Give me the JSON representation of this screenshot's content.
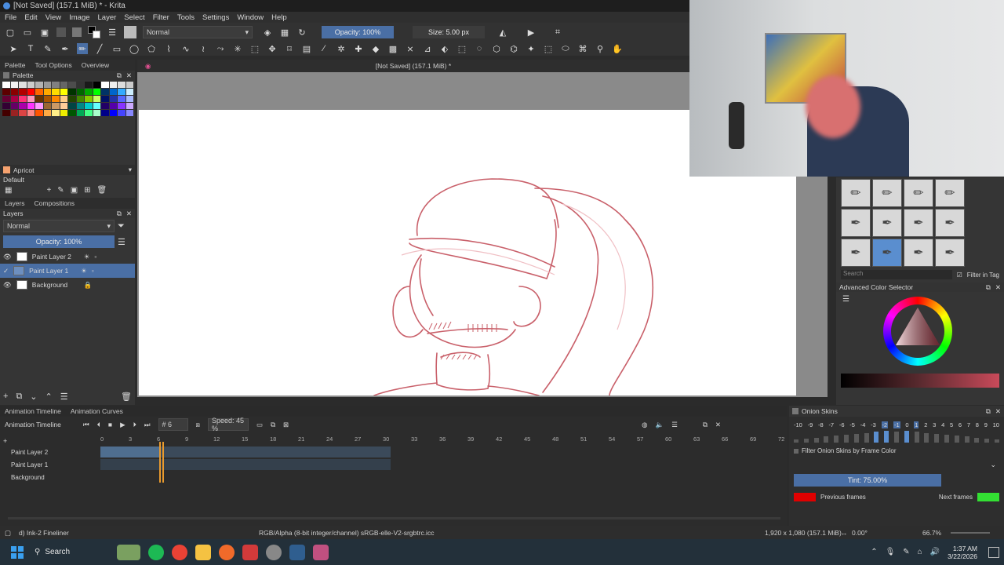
{
  "window": {
    "title": "[Not Saved]  (157.1 MiB) * - Krita"
  },
  "menu": [
    "File",
    "Edit",
    "View",
    "Image",
    "Layer",
    "Select",
    "Filter",
    "Tools",
    "Settings",
    "Window",
    "Help"
  ],
  "toolbar": {
    "blend_mode": "Normal",
    "opacity": "Opacity: 100%",
    "size": "Size: 5.00 px"
  },
  "left_tabs": [
    "Palette",
    "Tool Options",
    "Overview"
  ],
  "palette": {
    "title": "Palette",
    "current_color": "Apricot",
    "palette_name": "Default"
  },
  "layers": {
    "tabs": [
      "Layers",
      "Compositions"
    ],
    "title": "Layers",
    "blend_mode": "Normal",
    "opacity": "Opacity:  100%",
    "items": [
      {
        "name": "Paint Layer 2"
      },
      {
        "name": "Paint Layer 1"
      },
      {
        "name": "Background"
      }
    ]
  },
  "canvas": {
    "doc_title": "[Not Saved]  (157.1 MiB) *"
  },
  "brush_panel": {
    "search_placeholder": "Search",
    "filter_label": "Filter in Tag"
  },
  "color_selector": {
    "title": "Advanced Color Selector"
  },
  "timeline": {
    "tabs": [
      "Animation Timeline",
      "Animation Curves"
    ],
    "title": "Animation Timeline",
    "frame": "# 6",
    "speed": "Speed: 45 %",
    "ruler": [
      "0",
      "3",
      "6",
      "9",
      "12",
      "15",
      "18",
      "21",
      "24",
      "27",
      "30",
      "33",
      "36",
      "39",
      "42",
      "45",
      "48",
      "51",
      "54",
      "57",
      "60",
      "63",
      "66",
      "69",
      "72"
    ],
    "layers": [
      "Paint Layer 2",
      "Paint Layer 1",
      "Background"
    ]
  },
  "onion": {
    "title": "Onion Skins",
    "numbers": [
      "-10",
      "-9",
      "-8",
      "-7",
      "-6",
      "-5",
      "-4",
      "-3",
      "-2",
      "-1",
      "0",
      "1",
      "2",
      "3",
      "4",
      "5",
      "6",
      "7",
      "8",
      "9",
      "10"
    ],
    "filter_label": "Filter Onion Skins by Frame Color",
    "tint": "Tint: 75.00%",
    "previous_label": "Previous frames",
    "next_label": "Next frames",
    "previous_color": "#e00000",
    "next_color": "#33e033"
  },
  "status": {
    "brush": "d) Ink-2 Fineliner",
    "color_profile": "RGB/Alpha (8-bit integer/channel)  sRGB-elle-V2-srgbtrc.icc",
    "dimensions": "1,920 x 1,080 (157.1 MiB)",
    "rotation": "0.00°",
    "zoom": "66.7%"
  },
  "taskbar": {
    "search_label": "Search",
    "time": "1:37 AM",
    "date": "3/22/2026"
  }
}
